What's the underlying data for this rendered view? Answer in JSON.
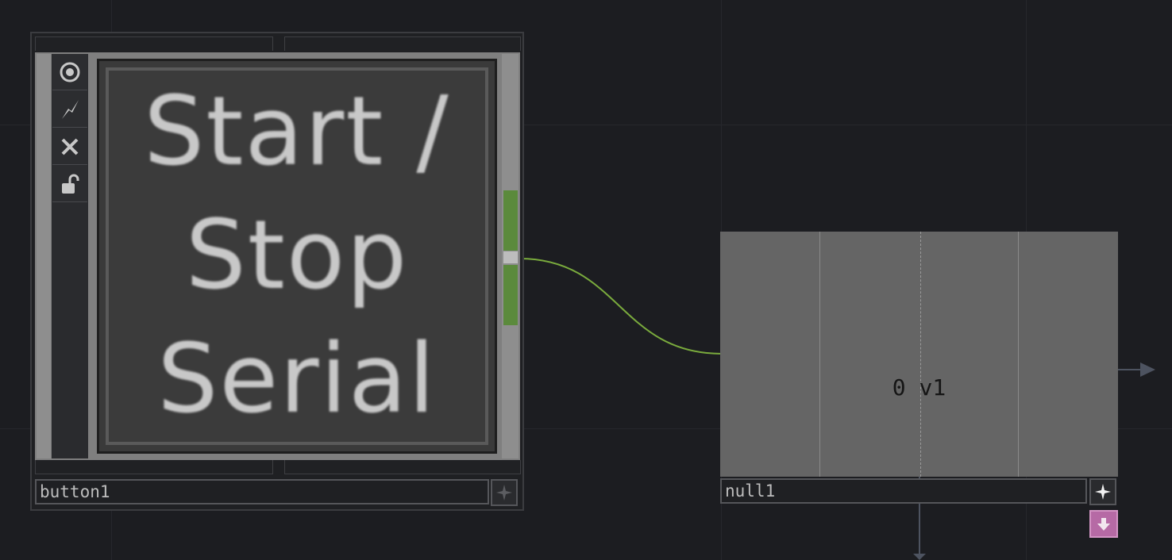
{
  "nodes": {
    "button": {
      "name": "button1",
      "label_lines": [
        "Start /",
        "Stop",
        "Serial"
      ],
      "controls": [
        "viewer-toggle-icon",
        "bypass-icon",
        "close-icon",
        "lock-icon"
      ]
    },
    "null": {
      "name": "null1",
      "display_value": "0 v1"
    }
  },
  "colors": {
    "background": "#1c1d21",
    "wire": "#7aab3d",
    "port_active": "#5b8a3c",
    "viewer_gray": "#656565",
    "flag_pink": "#b66aa5"
  }
}
